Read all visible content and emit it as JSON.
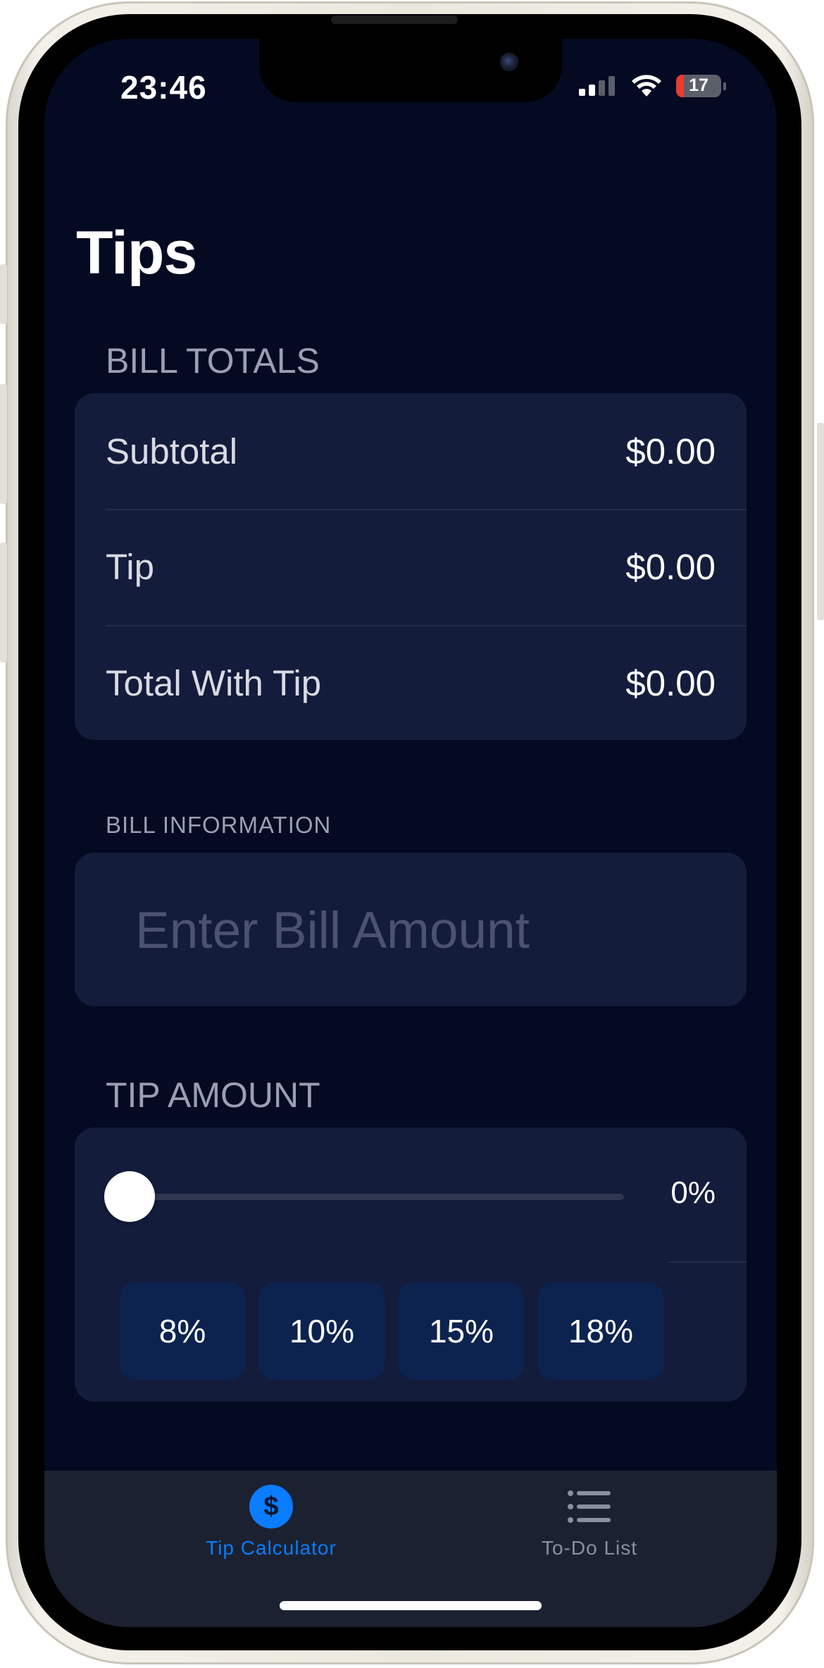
{
  "status_bar": {
    "time": "23:46",
    "battery_level": "17",
    "icons": [
      "cellular-signal-icon",
      "wifi-icon",
      "battery-icon"
    ]
  },
  "page": {
    "title": "Tips"
  },
  "bill_totals": {
    "header": "BILL TOTALS",
    "rows": [
      {
        "label": "Subtotal",
        "value": "$0.00"
      },
      {
        "label": "Tip",
        "value": "$0.00"
      },
      {
        "label": "Total With Tip",
        "value": "$0.00"
      }
    ]
  },
  "bill_information": {
    "header": "BILL INFORMATION",
    "input_placeholder": "Enter Bill Amount",
    "input_value": ""
  },
  "tip_amount": {
    "header": "TIP AMOUNT",
    "slider_value_fraction": 0,
    "slider_label": "0%",
    "presets": [
      "8%",
      "10%",
      "15%",
      "18%"
    ]
  },
  "tab_bar": {
    "tabs": [
      {
        "label": "Tip Calculator",
        "icon": "dollar-sign-icon",
        "selected": true
      },
      {
        "label": "To-Do List",
        "icon": "list-icon",
        "selected": false
      }
    ]
  },
  "colors": {
    "background": "#030a22",
    "card": "#141c3c",
    "accent": "#0a7cff",
    "preset_button": "#0c2350",
    "secondary_text": "#9aa0b3"
  }
}
